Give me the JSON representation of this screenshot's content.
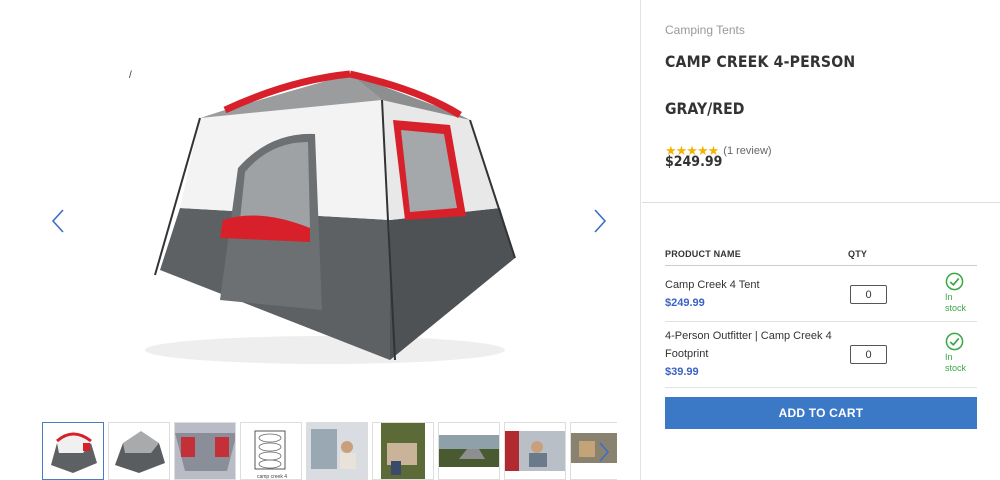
{
  "gallery": {
    "stray_mark": "/",
    "main_image": "camp-creek-4-person-tent-gray-red",
    "prev_icon": "chevron-left-icon",
    "next_icon": "chevron-right-icon",
    "thumbnails": [
      {
        "name": "tent-front",
        "active": true
      },
      {
        "name": "tent-gray-angle",
        "active": false
      },
      {
        "name": "tent-interior-top",
        "active": false
      },
      {
        "name": "tent-floor-diagram",
        "active": false
      },
      {
        "name": "tent-person-inside",
        "active": false
      },
      {
        "name": "tent-staking-grass",
        "active": false
      },
      {
        "name": "tent-field",
        "active": false
      },
      {
        "name": "tent-interior-person",
        "active": false
      },
      {
        "name": "tent-more",
        "active": false
      }
    ],
    "diagram_caption": "camp creek 4",
    "thumb_next_icon": "chevron-right-icon"
  },
  "product": {
    "breadcrumb": "Camping Tents",
    "title": "CAMP CREEK 4-PERSON",
    "subtitle": "GRAY/RED",
    "stars": "★★★★★",
    "review_count": "(1 review)",
    "rating": 5,
    "price": "$249.99"
  },
  "table": {
    "col_name": "PRODUCT NAME",
    "col_qty": "QTY",
    "rows": [
      {
        "name": "Camp Creek 4 Tent",
        "price": "$249.99",
        "qty": "0",
        "stock": "In stock"
      },
      {
        "name": "4-Person Outfitter | Camp Creek 4 Footprint",
        "price": "$39.99",
        "qty": "0",
        "stock": "In stock"
      }
    ]
  },
  "cart": {
    "add_label": "ADD TO CART"
  },
  "colors": {
    "accent_blue": "#3b79c7",
    "price_blue": "#3a62c4",
    "stock_green": "#3aa845",
    "star": "#f5b301",
    "tent_red": "#d8202a",
    "tent_gray": "#5e6163"
  }
}
